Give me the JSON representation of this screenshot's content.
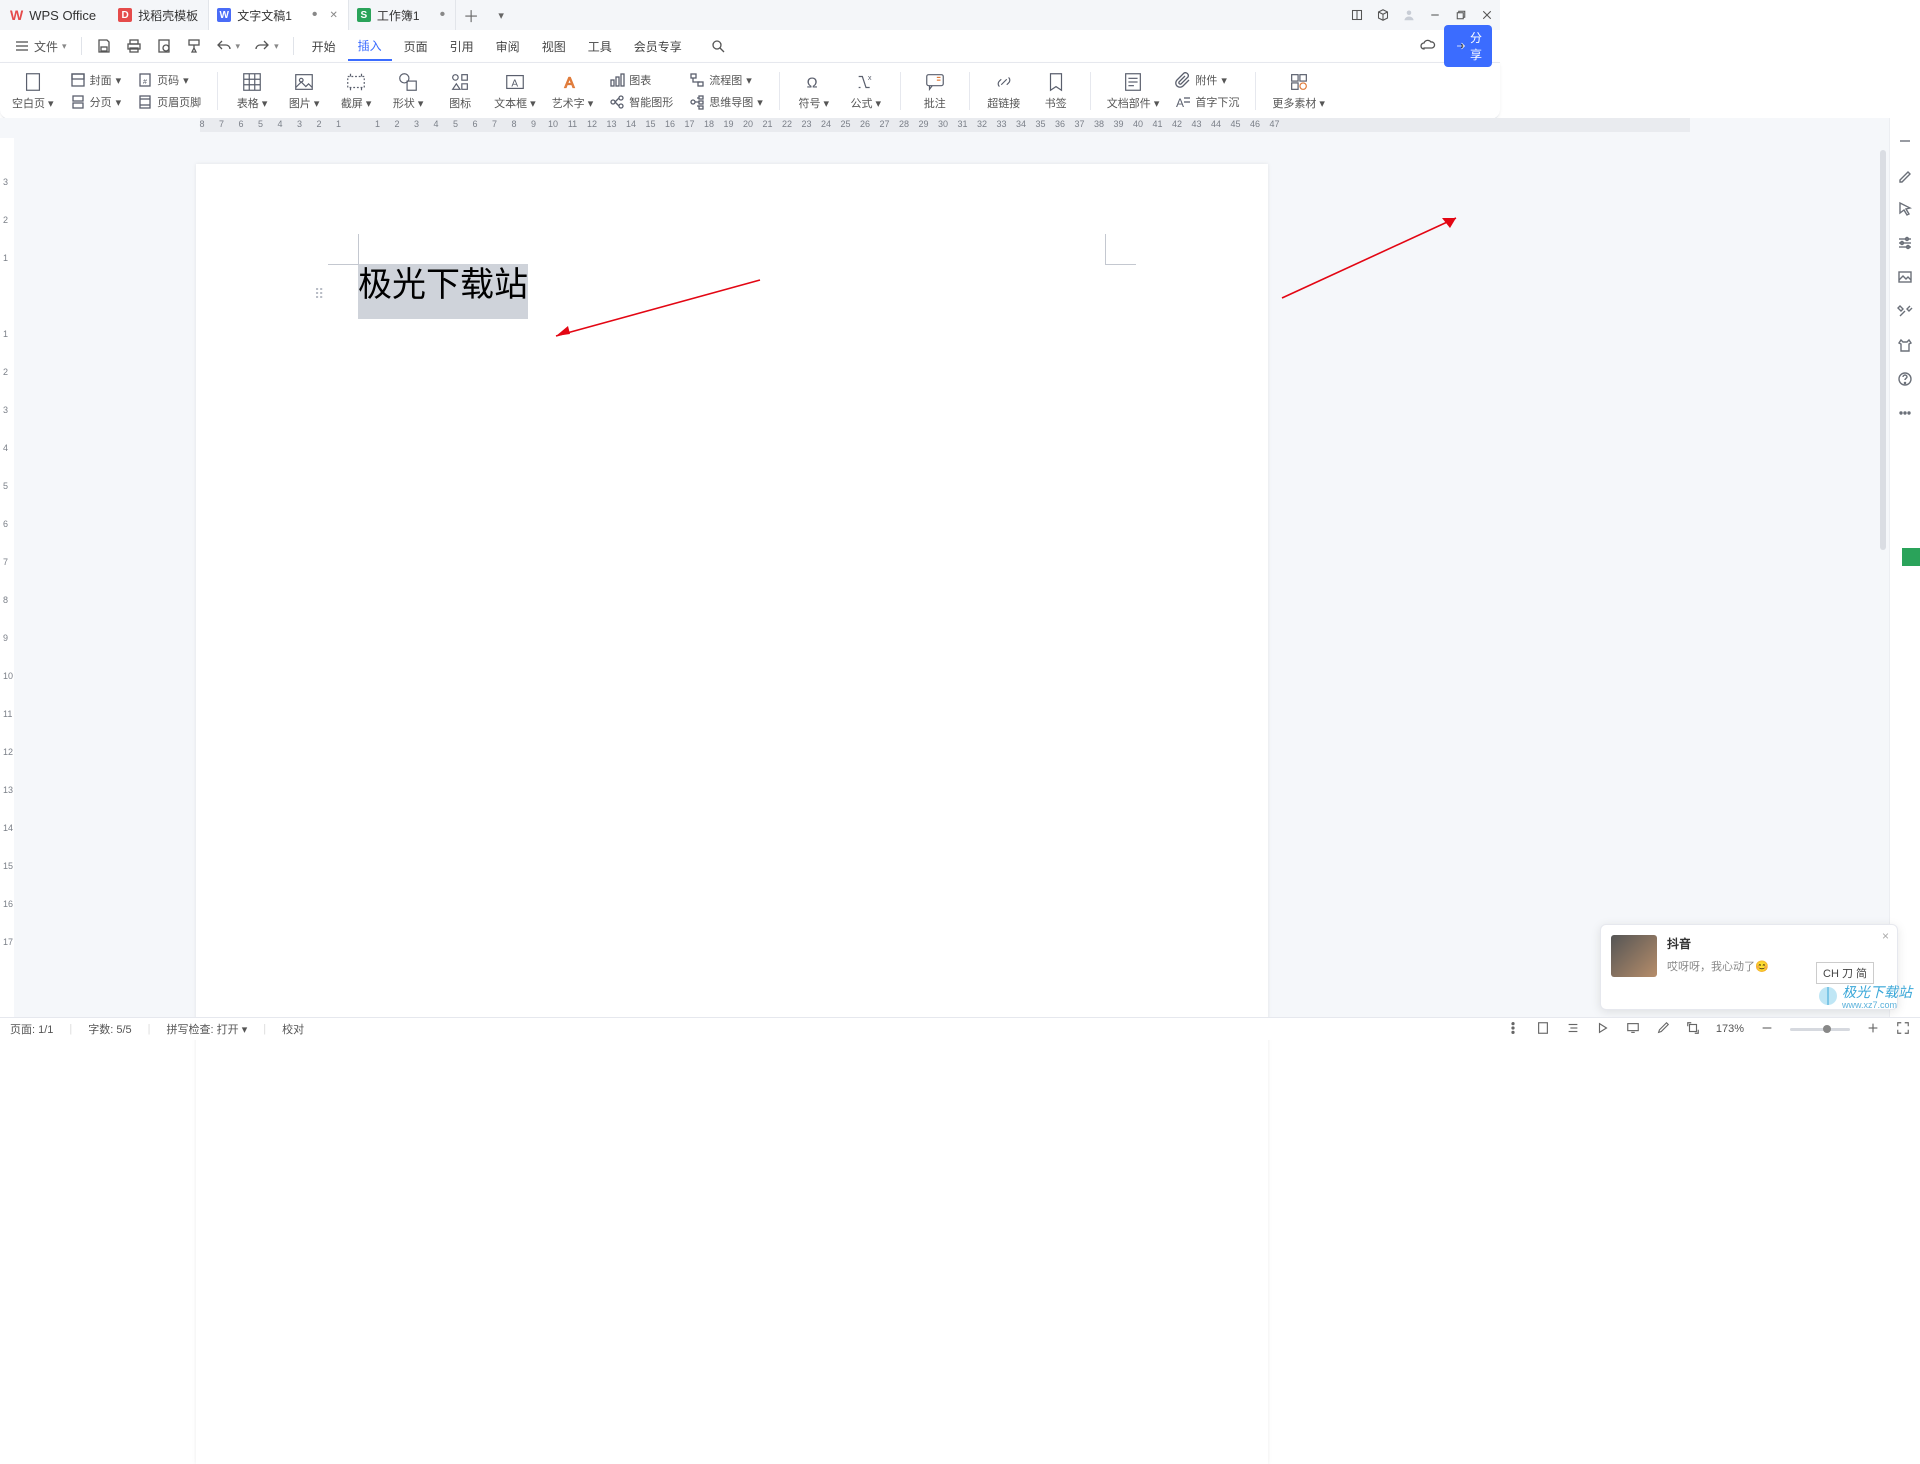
{
  "titlebar": {
    "brand": "WPS Office",
    "tabs": [
      {
        "label": "找稻壳模板",
        "icon": "red"
      },
      {
        "label": "文字文稿1",
        "icon": "blue",
        "active": true,
        "dirty": true
      },
      {
        "label": "工作簿1",
        "icon": "green",
        "dirty": true
      }
    ]
  },
  "menubar": {
    "file": "文件",
    "tabs": [
      "开始",
      "插入",
      "页面",
      "引用",
      "审阅",
      "视图",
      "工具",
      "会员专享"
    ],
    "active_tab": "插入",
    "share": "分享"
  },
  "ribbon": {
    "groups": [
      [
        {
          "l": "空白页",
          "d": true
        },
        {
          "col": [
            {
              "l": "封面",
              "d": true
            },
            {
              "l": "页码",
              "d": true
            }
          ]
        },
        {
          "col": [
            {
              "l": "分页",
              "d": true
            },
            {
              "l": "页眉页脚"
            }
          ]
        }
      ],
      [
        {
          "l": "表格",
          "d": true
        },
        {
          "l": "图片",
          "d": true
        },
        {
          "l": "截屏",
          "d": true
        },
        {
          "l": "形状",
          "d": true
        },
        {
          "l": "图标"
        },
        {
          "l": "文本框",
          "d": true
        },
        {
          "l": "艺术字",
          "d": true
        },
        {
          "col": [
            {
              "l": "图表"
            },
            {
              "l": "智能图形"
            }
          ]
        },
        {
          "col": [
            {
              "l": "流程图",
              "d": true
            },
            {
              "l": "思维导图",
              "d": true
            }
          ]
        }
      ],
      [
        {
          "l": "符号",
          "d": true
        },
        {
          "l": "公式",
          "d": true
        }
      ],
      [
        {
          "l": "批注"
        }
      ],
      [
        {
          "l": "超链接"
        },
        {
          "l": "书签"
        }
      ],
      [
        {
          "l": "文档部件",
          "d": true
        },
        {
          "col": [
            {
              "l": "附件",
              "d": true
            },
            {
              "l": "首字下沉"
            }
          ]
        }
      ],
      [
        {
          "l": "更多素材",
          "d": true
        }
      ]
    ]
  },
  "document": {
    "selected_text": "极光下载站"
  },
  "ruler_h": [
    "8",
    "7",
    "6",
    "5",
    "4",
    "3",
    "2",
    "1",
    "",
    "1",
    "2",
    "3",
    "4",
    "5",
    "6",
    "7",
    "8",
    "9",
    "10",
    "11",
    "12",
    "13",
    "14",
    "15",
    "16",
    "17",
    "18",
    "19",
    "20",
    "21",
    "22",
    "23",
    "24",
    "25",
    "26",
    "27",
    "28",
    "29",
    "30",
    "31",
    "32",
    "33",
    "34",
    "35",
    "36",
    "37",
    "38",
    "39",
    "40",
    "41",
    "42",
    "43",
    "44",
    "45",
    "46",
    "47"
  ],
  "ruler_v": [
    "",
    "3",
    "2",
    "1",
    "",
    "1",
    "2",
    "3",
    "4",
    "5",
    "6",
    "7",
    "8",
    "9",
    "10",
    "11",
    "12",
    "13",
    "14",
    "15",
    "16",
    "17"
  ],
  "notification": {
    "title": "抖音",
    "body": "哎呀呀，我心动了😊"
  },
  "ime": "CH 刀 简",
  "status": {
    "page": "页面: 1/1",
    "words": "字数: 5/5",
    "spell": "拼写检查: 打开",
    "proof": "校对",
    "zoom": "173%"
  },
  "watermark": {
    "t": "极光下载站",
    "s": "www.xz7.com"
  }
}
